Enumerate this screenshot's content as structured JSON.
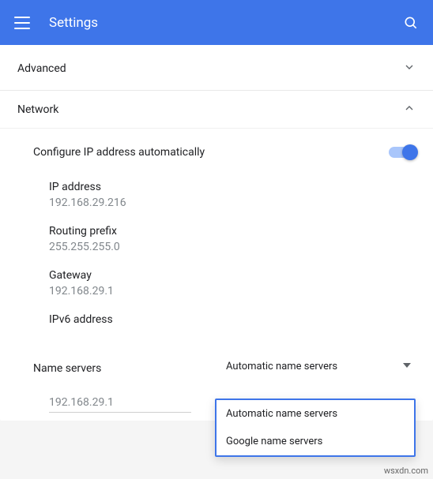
{
  "app": {
    "title": "Settings"
  },
  "sections": {
    "advanced": "Advanced",
    "network": "Network"
  },
  "network": {
    "auto_ip_label": "Configure IP address automatically",
    "ip_label": "IP address",
    "ip_value": "192.168.29.216",
    "prefix_label": "Routing prefix",
    "prefix_value": "255.255.255.0",
    "gateway_label": "Gateway",
    "gateway_value": "192.168.29.1",
    "ipv6_label": "IPv6 address",
    "ipv6_value": "",
    "ns_label": "Name servers",
    "ns_selected": "Automatic name servers",
    "ns_options": {
      "0": "Automatic name servers",
      "1": "Google name servers"
    },
    "ns_input_value": "192.168.29.1"
  },
  "watermark": "wsxdn.com"
}
